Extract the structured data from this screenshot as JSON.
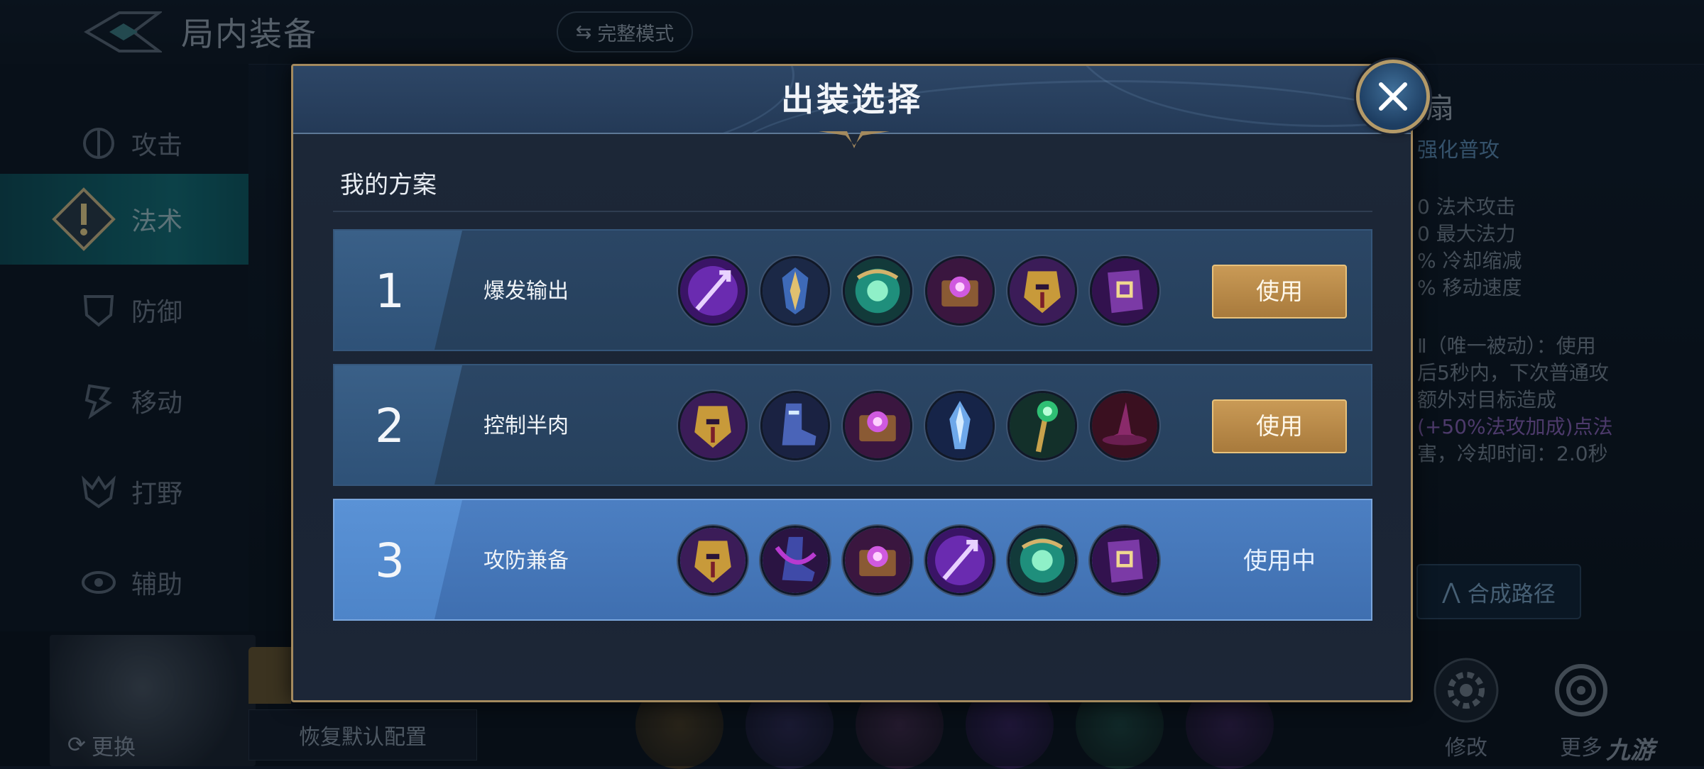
{
  "header": {
    "title": "局内装备",
    "mode_toggle_label": "完整模式"
  },
  "sidebar": {
    "items": [
      {
        "label": "攻击",
        "icon": "attack-icon",
        "active": false
      },
      {
        "label": "法术",
        "icon": "magic-icon",
        "active": true
      },
      {
        "label": "防御",
        "icon": "defense-icon",
        "active": false
      },
      {
        "label": "移动",
        "icon": "movement-icon",
        "active": false
      },
      {
        "label": "打野",
        "icon": "jungle-icon",
        "active": false
      },
      {
        "label": "辅助",
        "icon": "support-icon",
        "active": false
      }
    ]
  },
  "item_detail": {
    "name_partial": "扇",
    "subtitle_partial": "强化普攻",
    "stats": [
      "0 法术攻击",
      "0 最大法力",
      "% 冷却缩减",
      "% 移动速度"
    ],
    "passive_lines": [
      "Ⅱ（唯一被动）：使用",
      "后5秒内，下次普通攻",
      "额外对目标造成",
      "(+50%法攻加成)点法",
      "害，冷却时间：2.0秒"
    ],
    "combine_label": "合成路径"
  },
  "bottom": {
    "swap_label": "更换",
    "restore_label": "恢复默认配置",
    "modify_label": "修改",
    "more_label": "更多",
    "watermark": "九游"
  },
  "modal": {
    "title": "出装选择",
    "section_title": "我的方案",
    "use_label": "使用",
    "in_use_label": "使用中",
    "plans": [
      {
        "number": "1",
        "name": "爆发输出",
        "status": "use",
        "items": [
          "purple-spear-icon",
          "blue-armor-icon",
          "green-orb-icon",
          "purple-tome-icon",
          "gold-mask-icon",
          "purple-book-icon"
        ]
      },
      {
        "number": "2",
        "name": "控制半肉",
        "status": "use",
        "items": [
          "gold-mask-icon",
          "blue-boots-icon",
          "purple-tome-icon",
          "ice-shard-icon",
          "green-staff-icon",
          "red-hat-icon"
        ]
      },
      {
        "number": "3",
        "name": "攻防兼备",
        "status": "in_use",
        "items": [
          "gold-mask-icon",
          "purple-boots-icon",
          "purple-tome-icon",
          "purple-spear-icon",
          "green-orb-icon",
          "purple-book-icon"
        ]
      }
    ]
  },
  "colors": {
    "gold": "#c99a56",
    "active_plan": "#4c7fc2",
    "plan_bg": "#2b4665",
    "active_category": "#147079"
  }
}
